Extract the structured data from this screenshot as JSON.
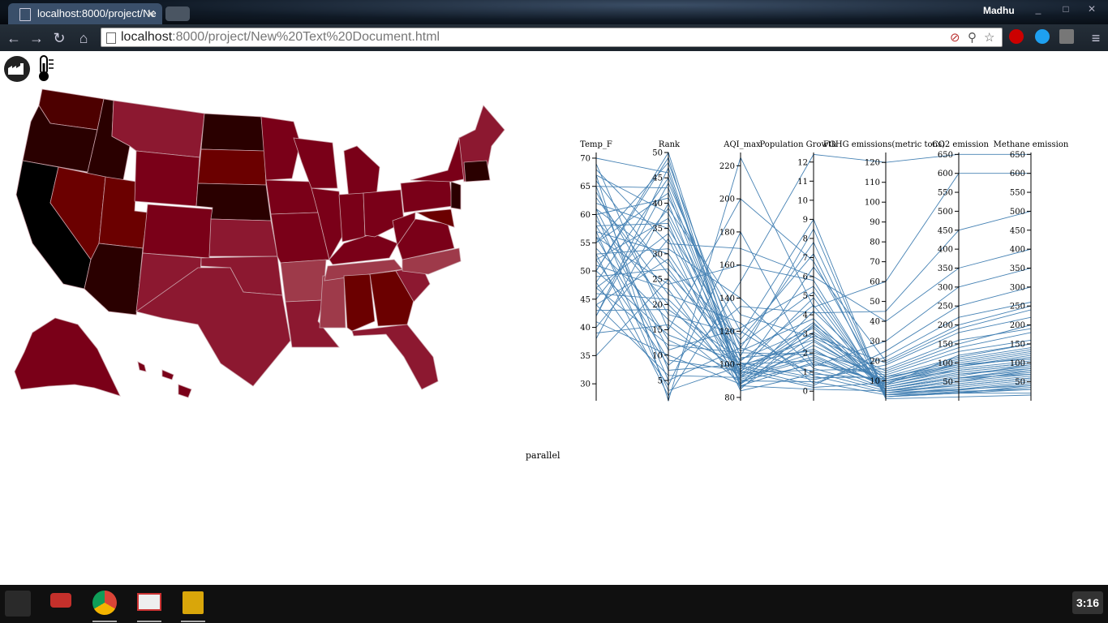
{
  "browser": {
    "tab_title": "localhost:8000/project/Ne",
    "user": "Madhu",
    "url_host": "localhost",
    "url_rest": ":8000/project/New%20Text%20Document.html"
  },
  "page": {
    "parallel_label": "parallel",
    "toggle_icons": [
      "factory-icon",
      "thermometer-icon"
    ],
    "map_colors": [
      "#000000",
      "#2a0000",
      "#4d0000",
      "#6b0000",
      "#7a0018",
      "#8c1830",
      "#9e3a4a"
    ]
  },
  "chart_data": {
    "type": "parallel",
    "title": "",
    "dimensions": [
      {
        "name": "Temp_F",
        "ticks": [
          30,
          35,
          40,
          45,
          50,
          55,
          60,
          65,
          70
        ],
        "range": [
          27,
          71
        ]
      },
      {
        "name": "Rank",
        "ticks": [
          5,
          10,
          15,
          20,
          25,
          30,
          35,
          40,
          45,
          50
        ],
        "range": [
          1,
          50
        ]
      },
      {
        "name": "AQI_max",
        "ticks": [
          80,
          100,
          120,
          140,
          160,
          180,
          200,
          220
        ],
        "range": [
          78,
          228
        ]
      },
      {
        "name": "Population Growth",
        "ticks": [
          0,
          1,
          2,
          3,
          4,
          5,
          6,
          7,
          8,
          9,
          10,
          11,
          12
        ],
        "range": [
          -0.5,
          12.5
        ]
      },
      {
        "name": "FGHG emissions(metric tons)",
        "ticks": [
          10,
          20,
          30,
          40,
          50,
          60,
          70,
          80,
          90,
          100,
          110,
          120
        ],
        "range": [
          0,
          125
        ]
      },
      {
        "name": "CO2 emission",
        "ticks": [
          50,
          100,
          150,
          200,
          250,
          300,
          350,
          400,
          450,
          500,
          550,
          600,
          650
        ],
        "range": [
          0,
          655
        ]
      },
      {
        "name": "Methane emission",
        "ticks": [
          50,
          100,
          150,
          200,
          250,
          300,
          350,
          400,
          450,
          500,
          550,
          600,
          650
        ],
        "range": [
          0,
          655
        ]
      }
    ],
    "line_color": "#4682b4",
    "lines": [
      [
        70,
        46,
        90,
        0.5,
        3,
        20,
        30
      ],
      [
        50,
        49,
        85,
        3.5,
        12,
        95,
        110
      ],
      [
        48,
        45,
        100,
        2.2,
        6,
        60,
        80
      ],
      [
        42,
        44,
        110,
        1.0,
        5,
        40,
        60
      ],
      [
        65,
        43,
        95,
        6.5,
        20,
        200,
        250
      ],
      [
        55,
        42,
        92,
        1.8,
        8,
        120,
        150
      ],
      [
        60,
        41,
        120,
        0.8,
        4,
        30,
        40
      ],
      [
        38,
        40,
        88,
        4.2,
        10,
        80,
        100
      ],
      [
        45,
        39,
        130,
        2.8,
        15,
        150,
        200
      ],
      [
        67,
        38,
        105,
        8.5,
        2,
        20,
        20
      ],
      [
        52,
        37,
        98,
        0.3,
        25,
        250,
        300
      ],
      [
        58,
        36,
        87,
        1.5,
        9,
        90,
        120
      ],
      [
        62,
        35,
        112,
        5.2,
        3,
        30,
        50
      ],
      [
        47,
        34,
        96,
        3.0,
        7,
        70,
        90
      ],
      [
        40,
        33,
        84,
        0.9,
        11,
        110,
        140
      ],
      [
        68,
        32,
        170,
        6.0,
        40,
        350,
        400
      ],
      [
        53,
        31,
        140,
        1.2,
        6,
        60,
        70
      ],
      [
        57,
        30,
        102,
        4.5,
        4,
        40,
        60
      ],
      [
        44,
        29,
        93,
        2.0,
        14,
        140,
        180
      ],
      [
        61,
        28,
        115,
        7.2,
        1,
        10,
        15
      ],
      [
        49,
        27,
        99,
        0.6,
        18,
        180,
        220
      ],
      [
        66,
        26,
        108,
        3.8,
        5,
        50,
        80
      ],
      [
        35,
        25,
        90,
        1.4,
        13,
        130,
        160
      ],
      [
        56,
        24,
        160,
        5.8,
        2,
        20,
        40
      ],
      [
        51,
        23,
        86,
        2.6,
        9,
        95,
        110
      ],
      [
        63,
        22,
        125,
        0.4,
        22,
        220,
        260
      ],
      [
        46,
        21,
        97,
        4.9,
        3,
        35,
        55
      ],
      [
        59,
        20,
        91,
        1.7,
        8,
        85,
        105
      ],
      [
        43,
        19,
        103,
        3.3,
        6,
        65,
        95
      ],
      [
        64,
        18,
        118,
        9.0,
        2,
        25,
        30
      ],
      [
        54,
        17,
        95,
        1.1,
        16,
        160,
        190
      ],
      [
        39,
        16,
        89,
        2.4,
        10,
        100,
        130
      ],
      [
        69,
        15,
        200,
        6.8,
        5,
        55,
        75
      ],
      [
        50,
        14,
        101,
        0.7,
        12,
        115,
        150
      ],
      [
        58,
        13,
        94,
        3.6,
        4,
        45,
        65
      ],
      [
        47,
        12,
        107,
        1.9,
        7,
        75,
        95
      ],
      [
        61,
        11,
        122,
        5.5,
        3,
        28,
        45
      ],
      [
        41,
        10,
        88,
        2.9,
        19,
        190,
        240
      ],
      [
        56,
        9,
        96,
        0.2,
        9,
        90,
        115
      ],
      [
        52,
        8,
        135,
        4.1,
        45,
        450,
        500
      ],
      [
        65,
        7,
        100,
        1.6,
        6,
        60,
        85
      ],
      [
        44,
        6,
        92,
        3.1,
        11,
        105,
        135
      ],
      [
        60,
        5,
        110,
        7.8,
        2,
        22,
        35
      ],
      [
        48,
        4,
        180,
        1.3,
        30,
        300,
        350
      ],
      [
        57,
        3,
        99,
        2.7,
        8,
        80,
        100
      ],
      [
        53,
        2,
        150,
        12.4,
        120,
        650,
        650
      ],
      [
        67,
        1,
        225,
        4.4,
        60,
        600,
        600
      ],
      [
        42,
        47,
        87,
        0.1,
        5,
        50,
        70
      ],
      [
        55,
        48,
        104,
        2.1,
        10,
        95,
        125
      ],
      [
        50,
        50,
        93,
        3.4,
        7,
        70,
        85
      ]
    ]
  }
}
